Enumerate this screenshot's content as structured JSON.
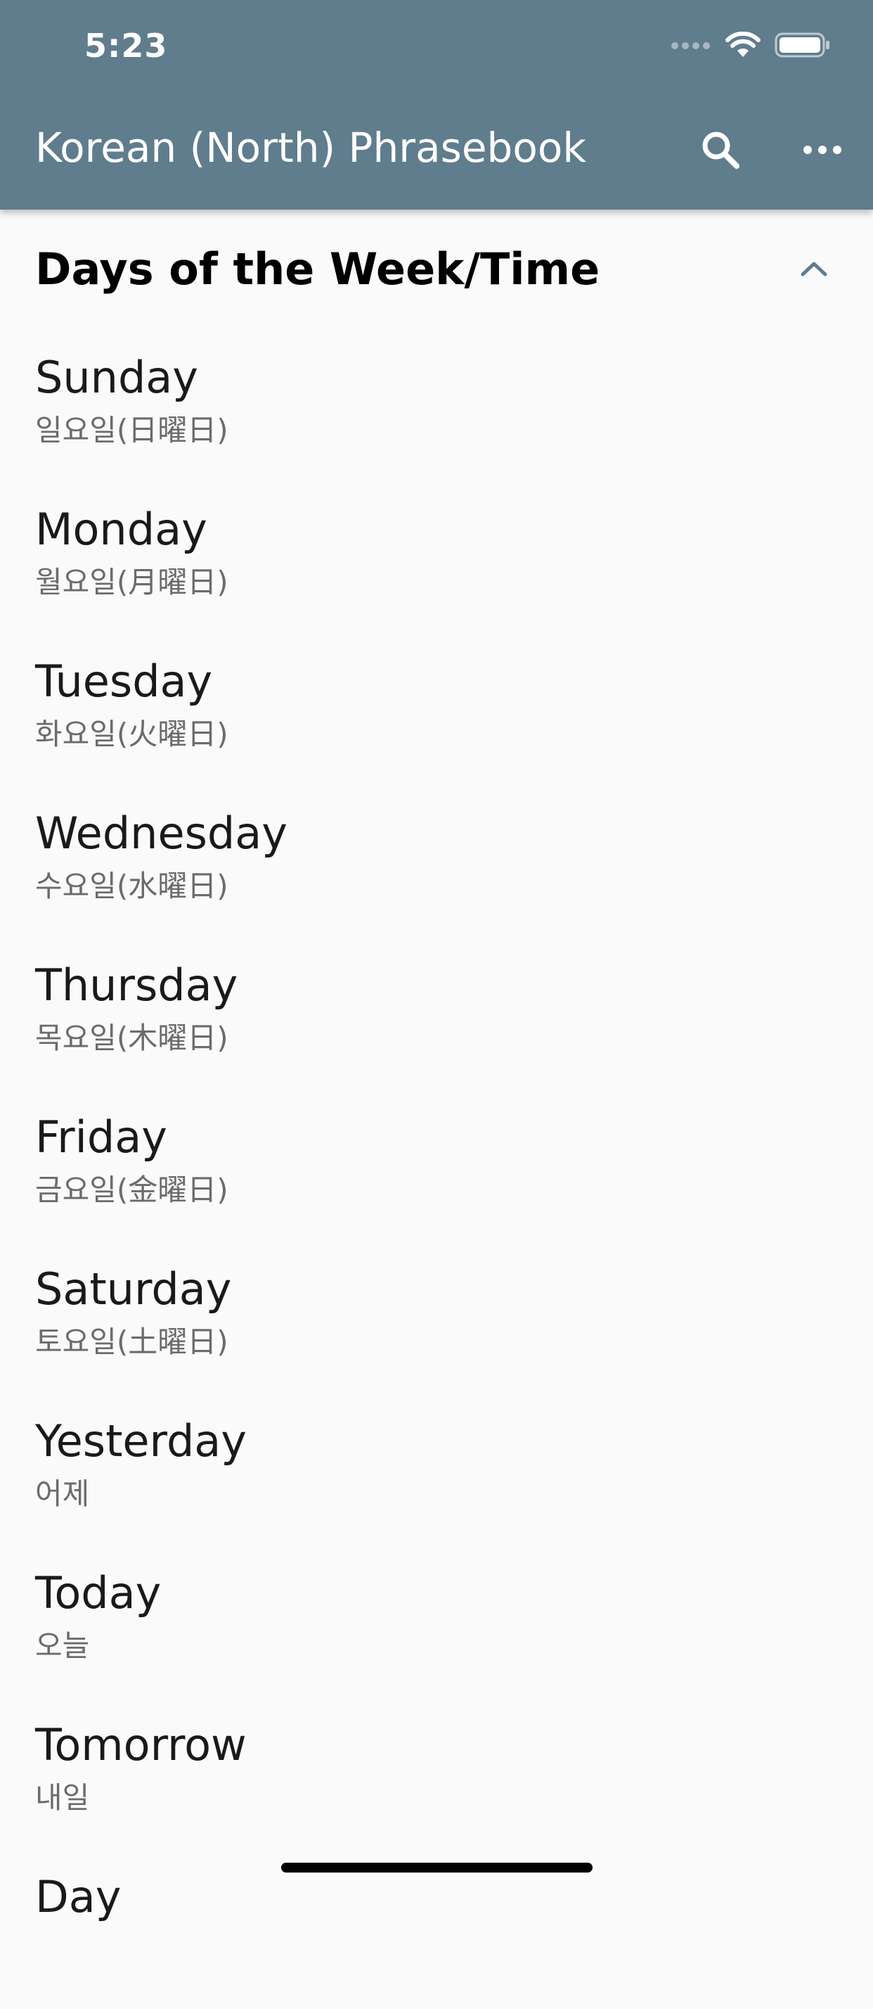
{
  "status_bar": {
    "time": "5:23"
  },
  "app_bar": {
    "title": "Korean (North) Phrasebook",
    "actions": [
      "search-icon",
      "more-horizontal-icon"
    ]
  },
  "section": {
    "title": "Days of the Week/Time",
    "expanded": true
  },
  "phrases": [
    {
      "english": "Sunday",
      "korean": "일요일(日曜日)"
    },
    {
      "english": "Monday",
      "korean": "월요일(月曜日)"
    },
    {
      "english": "Tuesday",
      "korean": "화요일(火曜日)"
    },
    {
      "english": "Wednesday",
      "korean": "수요일(水曜日)"
    },
    {
      "english": "Thursday",
      "korean": "목요일(木曜日)"
    },
    {
      "english": "Friday",
      "korean": "금요일(金曜日)"
    },
    {
      "english": "Saturday",
      "korean": "토요일(土曜日)"
    },
    {
      "english": "Yesterday",
      "korean": "어제"
    },
    {
      "english": "Today",
      "korean": "오늘"
    },
    {
      "english": "Tomorrow",
      "korean": "내일"
    },
    {
      "english": "Day",
      "korean": ""
    }
  ],
  "colors": {
    "app_bar": "#5f7d8d",
    "background": "#fafafa",
    "collapse_chevron": "#5f7d8d"
  }
}
